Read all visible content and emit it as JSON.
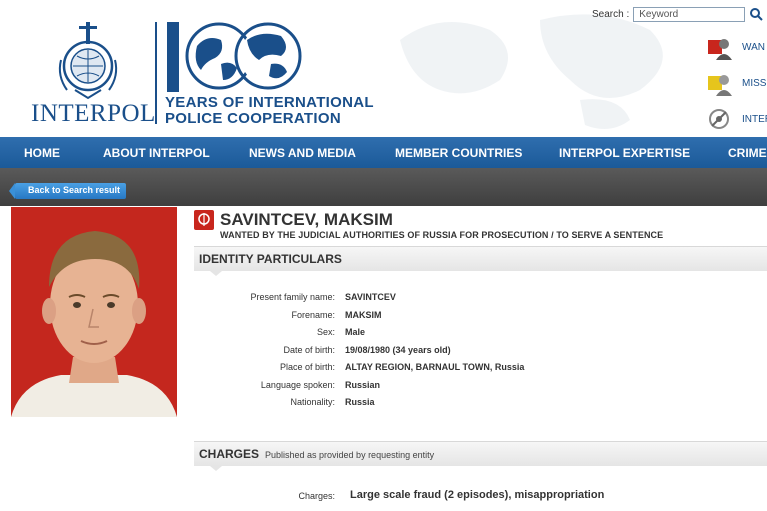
{
  "header": {
    "logo_text": "INTERPOL",
    "anniversary_number": "100",
    "anniversary_line1": "YEARS OF INTERNATIONAL",
    "anniversary_line2": "POLICE COOPERATION"
  },
  "search": {
    "label": "Search :",
    "placeholder": "Keyword"
  },
  "side_links": [
    {
      "label": "WAN",
      "icon": "wanted-notice-icon"
    },
    {
      "label": "MISSI",
      "icon": "missing-notice-icon"
    },
    {
      "label": "INTER",
      "icon": "interpol-icon"
    }
  ],
  "nav": {
    "items": [
      "HOME",
      "ABOUT INTERPOL",
      "NEWS AND MEDIA",
      "MEMBER COUNTRIES",
      "INTERPOL EXPERTISE",
      "CRIME"
    ]
  },
  "back_button": "Back to Search result",
  "notice": {
    "name": "SAVINTCEV, MAKSIM",
    "subtitle": "WANTED BY THE JUDICIAL AUTHORITIES OF RUSSIA FOR PROSECUTION / TO SERVE A SENTENCE"
  },
  "identity": {
    "heading": "IDENTITY PARTICULARS",
    "rows": [
      {
        "label": "Present family name:",
        "value": "SAVINTCEV"
      },
      {
        "label": "Forename:",
        "value": "MAKSIM"
      },
      {
        "label": "Sex:",
        "value": "Male"
      },
      {
        "label": "Date of birth:",
        "value": "19/08/1980 (34 years old)"
      },
      {
        "label": "Place of birth:",
        "value": "ALTAY REGION, BARNAUL TOWN, Russia"
      },
      {
        "label": "Language spoken:",
        "value": "Russian"
      },
      {
        "label": "Nationality:",
        "value": "Russia"
      }
    ]
  },
  "charges": {
    "heading": "CHARGES",
    "subheading": "Published as provided by requesting entity",
    "label": "Charges:",
    "value": "Large scale fraud (2 episodes), misappropriation"
  },
  "colors": {
    "nav_blue": "#1b5a99",
    "brand_blue": "#1a4f8a",
    "notice_red": "#c8261d"
  }
}
